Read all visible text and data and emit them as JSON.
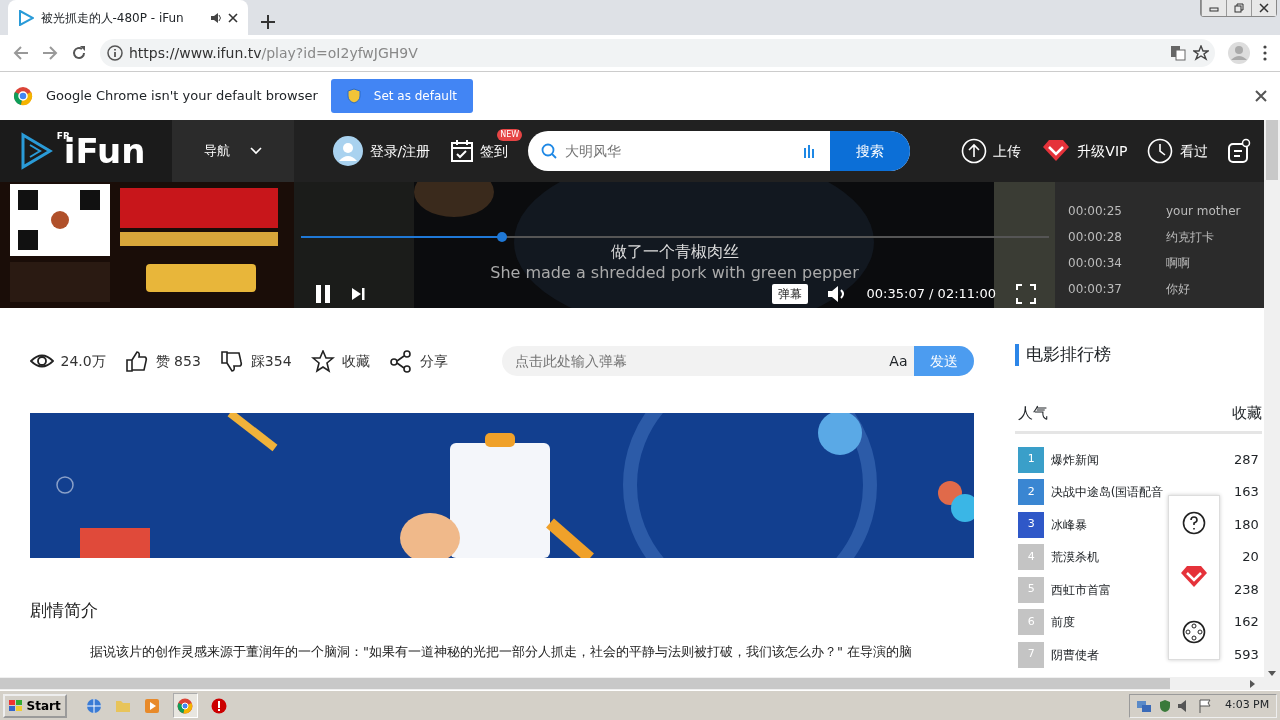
{
  "browser": {
    "tab": {
      "title": "被光抓走的人-480P - iFun"
    },
    "url": {
      "host": "https://www.ifun.tv",
      "path": "/play?id=oI2yfwJGH9V"
    },
    "infobar": {
      "message": "Google Chrome isn't your default browser",
      "button": "Set as default"
    }
  },
  "site": {
    "logo": {
      "badge": "FR",
      "name": "iFun"
    },
    "nav": "导航",
    "login": "登录/注册",
    "checkin": {
      "label": "签到",
      "badge": "NEW"
    },
    "search": {
      "placeholder": "大明风华",
      "button": "搜索"
    },
    "actions": [
      {
        "kind": "upload",
        "label": "上传"
      },
      {
        "kind": "vip",
        "label": "升级VIP"
      },
      {
        "kind": "history",
        "label": "看过"
      }
    ]
  },
  "player": {
    "subtitle": "做了一个青椒肉丝",
    "subtitle_en": "She made a shredded pork with green pepper",
    "level": 0.27,
    "playing": true,
    "danmaku_button": "弹幕",
    "time": "00:35:07 / 02:11:00"
  },
  "danmaku_list": [
    {
      "time": "00:00:25",
      "text": "your mother"
    },
    {
      "time": "00:00:28",
      "text": "约克打卡"
    },
    {
      "time": "00:00:34",
      "text": "啊啊"
    },
    {
      "time": "00:00:37",
      "text": "你好"
    }
  ],
  "stats": [
    {
      "kind": "views",
      "text": "24.0万"
    },
    {
      "kind": "like",
      "text": "赞 853"
    },
    {
      "kind": "dislike",
      "text": "踩354"
    },
    {
      "kind": "favorite",
      "text": "收藏"
    },
    {
      "kind": "share",
      "text": "分享"
    }
  ],
  "danmaku_input": {
    "placeholder": "点击此处输入弹幕",
    "font_button": "Aa",
    "send": "发送"
  },
  "synopsis": {
    "title": "剧情简介",
    "text": "据说该片的创作灵感来源于董润年的一个脑洞：\"如果有一道神秘的光把一部分人抓走，社会的平静与法则被打破，我们该怎么办？\" 在导演的脑"
  },
  "ranking": {
    "title": "电影排行榜",
    "columns": [
      "人气",
      "收藏"
    ],
    "items": [
      {
        "rank": "1",
        "name": "爆炸新闻",
        "count": "287",
        "color": "#3a9fc9"
      },
      {
        "rank": "2",
        "name": "决战中途岛(国语配音",
        "count": "163",
        "color": "#3a86d2"
      },
      {
        "rank": "3",
        "name": "冰峰暴",
        "count": "180",
        "color": "#2f58c8"
      },
      {
        "rank": "4",
        "name": "荒漠杀机",
        "count": "20",
        "color": "#c4c4c4"
      },
      {
        "rank": "5",
        "name": "西虹市首富",
        "count": "238",
        "color": "#c4c4c4"
      },
      {
        "rank": "6",
        "name": "前度",
        "count": "162",
        "color": "#c4c4c4"
      },
      {
        "rank": "7",
        "name": "阴曹使者",
        "count": "593",
        "color": "#c4c4c4"
      }
    ]
  },
  "taskbar": {
    "start": "Start",
    "time": "4:03 PM"
  }
}
